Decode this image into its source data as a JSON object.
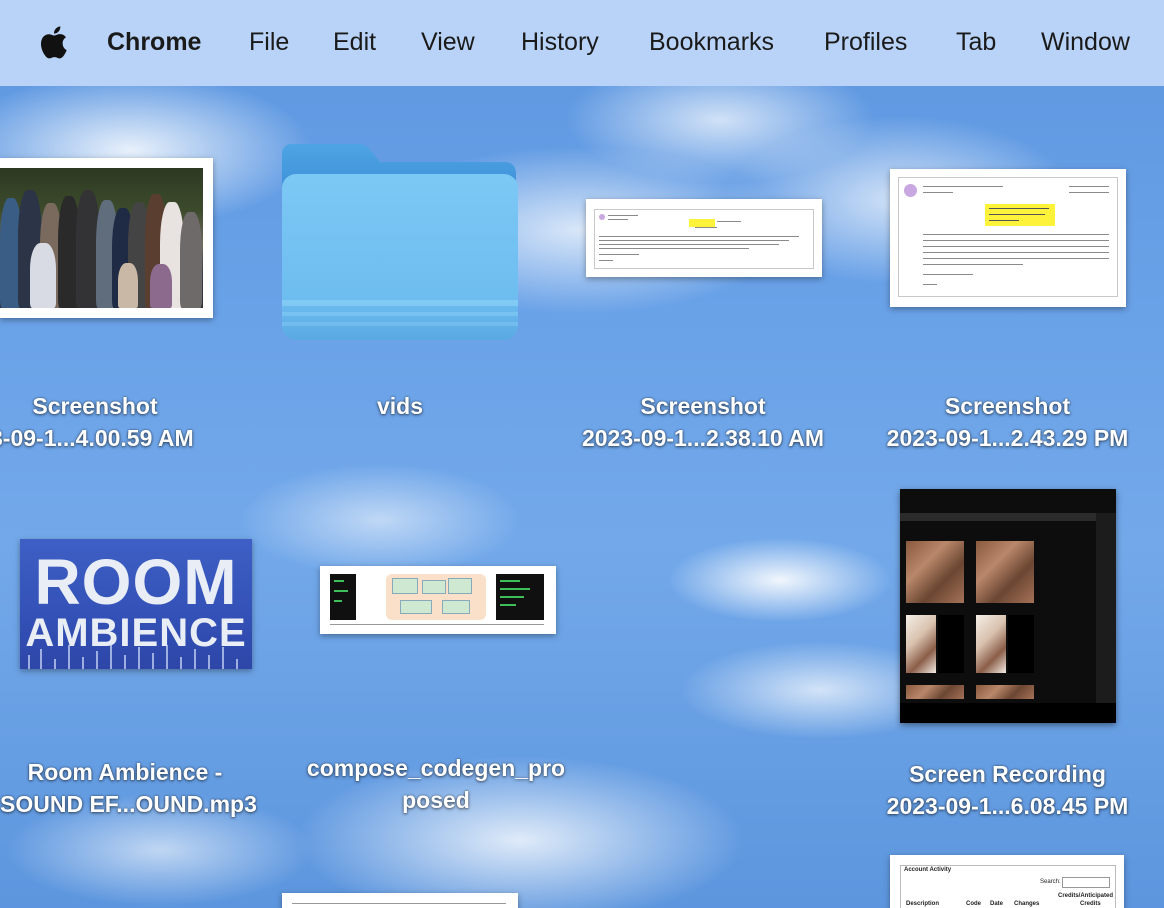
{
  "menubar": {
    "apple_icon": "apple-logo",
    "app_name": "Chrome",
    "items": [
      "File",
      "Edit",
      "View",
      "History",
      "Bookmarks",
      "Profiles",
      "Tab",
      "Window"
    ]
  },
  "desktop": {
    "items": [
      {
        "kind": "image",
        "line1": "Screenshot",
        "line2": "3-09-1...4.00.59 AM"
      },
      {
        "kind": "folder",
        "line1": "vids",
        "line2": ""
      },
      {
        "kind": "image",
        "line1": "Screenshot",
        "line2": "2023-09-1...2.38.10 AM"
      },
      {
        "kind": "image",
        "line1": "Screenshot",
        "line2": "2023-09-1...2.43.29 PM"
      },
      {
        "kind": "audio",
        "line1": "Room Ambience -",
        "line2": "SOUND EF...OUND.mp3",
        "art_line1": "ROOM",
        "art_line2": "AMBIENCE"
      },
      {
        "kind": "image",
        "line1": "compose_codegen_pro",
        "line2": "posed"
      },
      {
        "kind": "video",
        "line1": "Screen Recording",
        "line2": "2023-09-1...6.08.45 PM"
      },
      {
        "kind": "image",
        "art_title": "Account Activity",
        "art_search": "Search:",
        "art_header1": "Credits/Anticipated",
        "art_header2": "Credits",
        "art_cols": [
          "Description",
          "Code",
          "Date",
          "Changes"
        ]
      }
    ]
  },
  "colors": {
    "menubar": "#b8d3f7",
    "folder": "#6ec0f2",
    "highlight": "#fff23a",
    "room_bg": "#3452b8"
  }
}
